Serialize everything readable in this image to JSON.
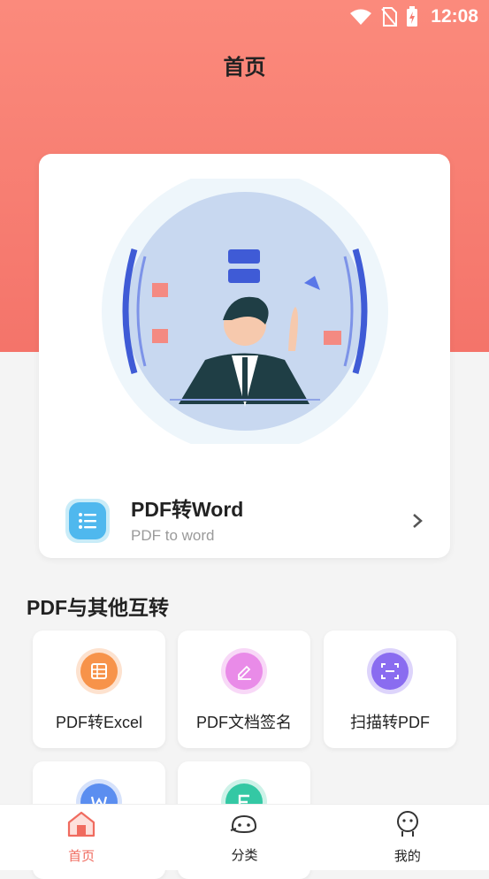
{
  "status_bar": {
    "time": "12:08"
  },
  "header": {
    "title": "首页"
  },
  "featured": {
    "title": "PDF转Word",
    "subtitle": "PDF to word"
  },
  "section": {
    "title": "PDF与其他互转",
    "items": [
      {
        "label": "PDF转Excel",
        "icon": "excel-table-icon",
        "color": "#f7934a"
      },
      {
        "label": "PDF文档签名",
        "icon": "pen-sign-icon",
        "color": "#e98be8"
      },
      {
        "label": "扫描转PDF",
        "icon": "scan-icon",
        "color": "#8a6cf0"
      },
      {
        "label": "",
        "icon": "word-icon",
        "color": "#5b8ef0"
      },
      {
        "label": "",
        "icon": "text-e-icon",
        "color": "#34c8a4"
      }
    ]
  },
  "tab_bar": {
    "tabs": [
      {
        "label": "首页",
        "icon": "home-icon"
      },
      {
        "label": "分类",
        "icon": "category-icon"
      },
      {
        "label": "我的",
        "icon": "profile-icon"
      }
    ],
    "active_color": "#f06b5f"
  },
  "colors": {
    "hero": "#f4746a",
    "accent": "#f06b5f"
  }
}
